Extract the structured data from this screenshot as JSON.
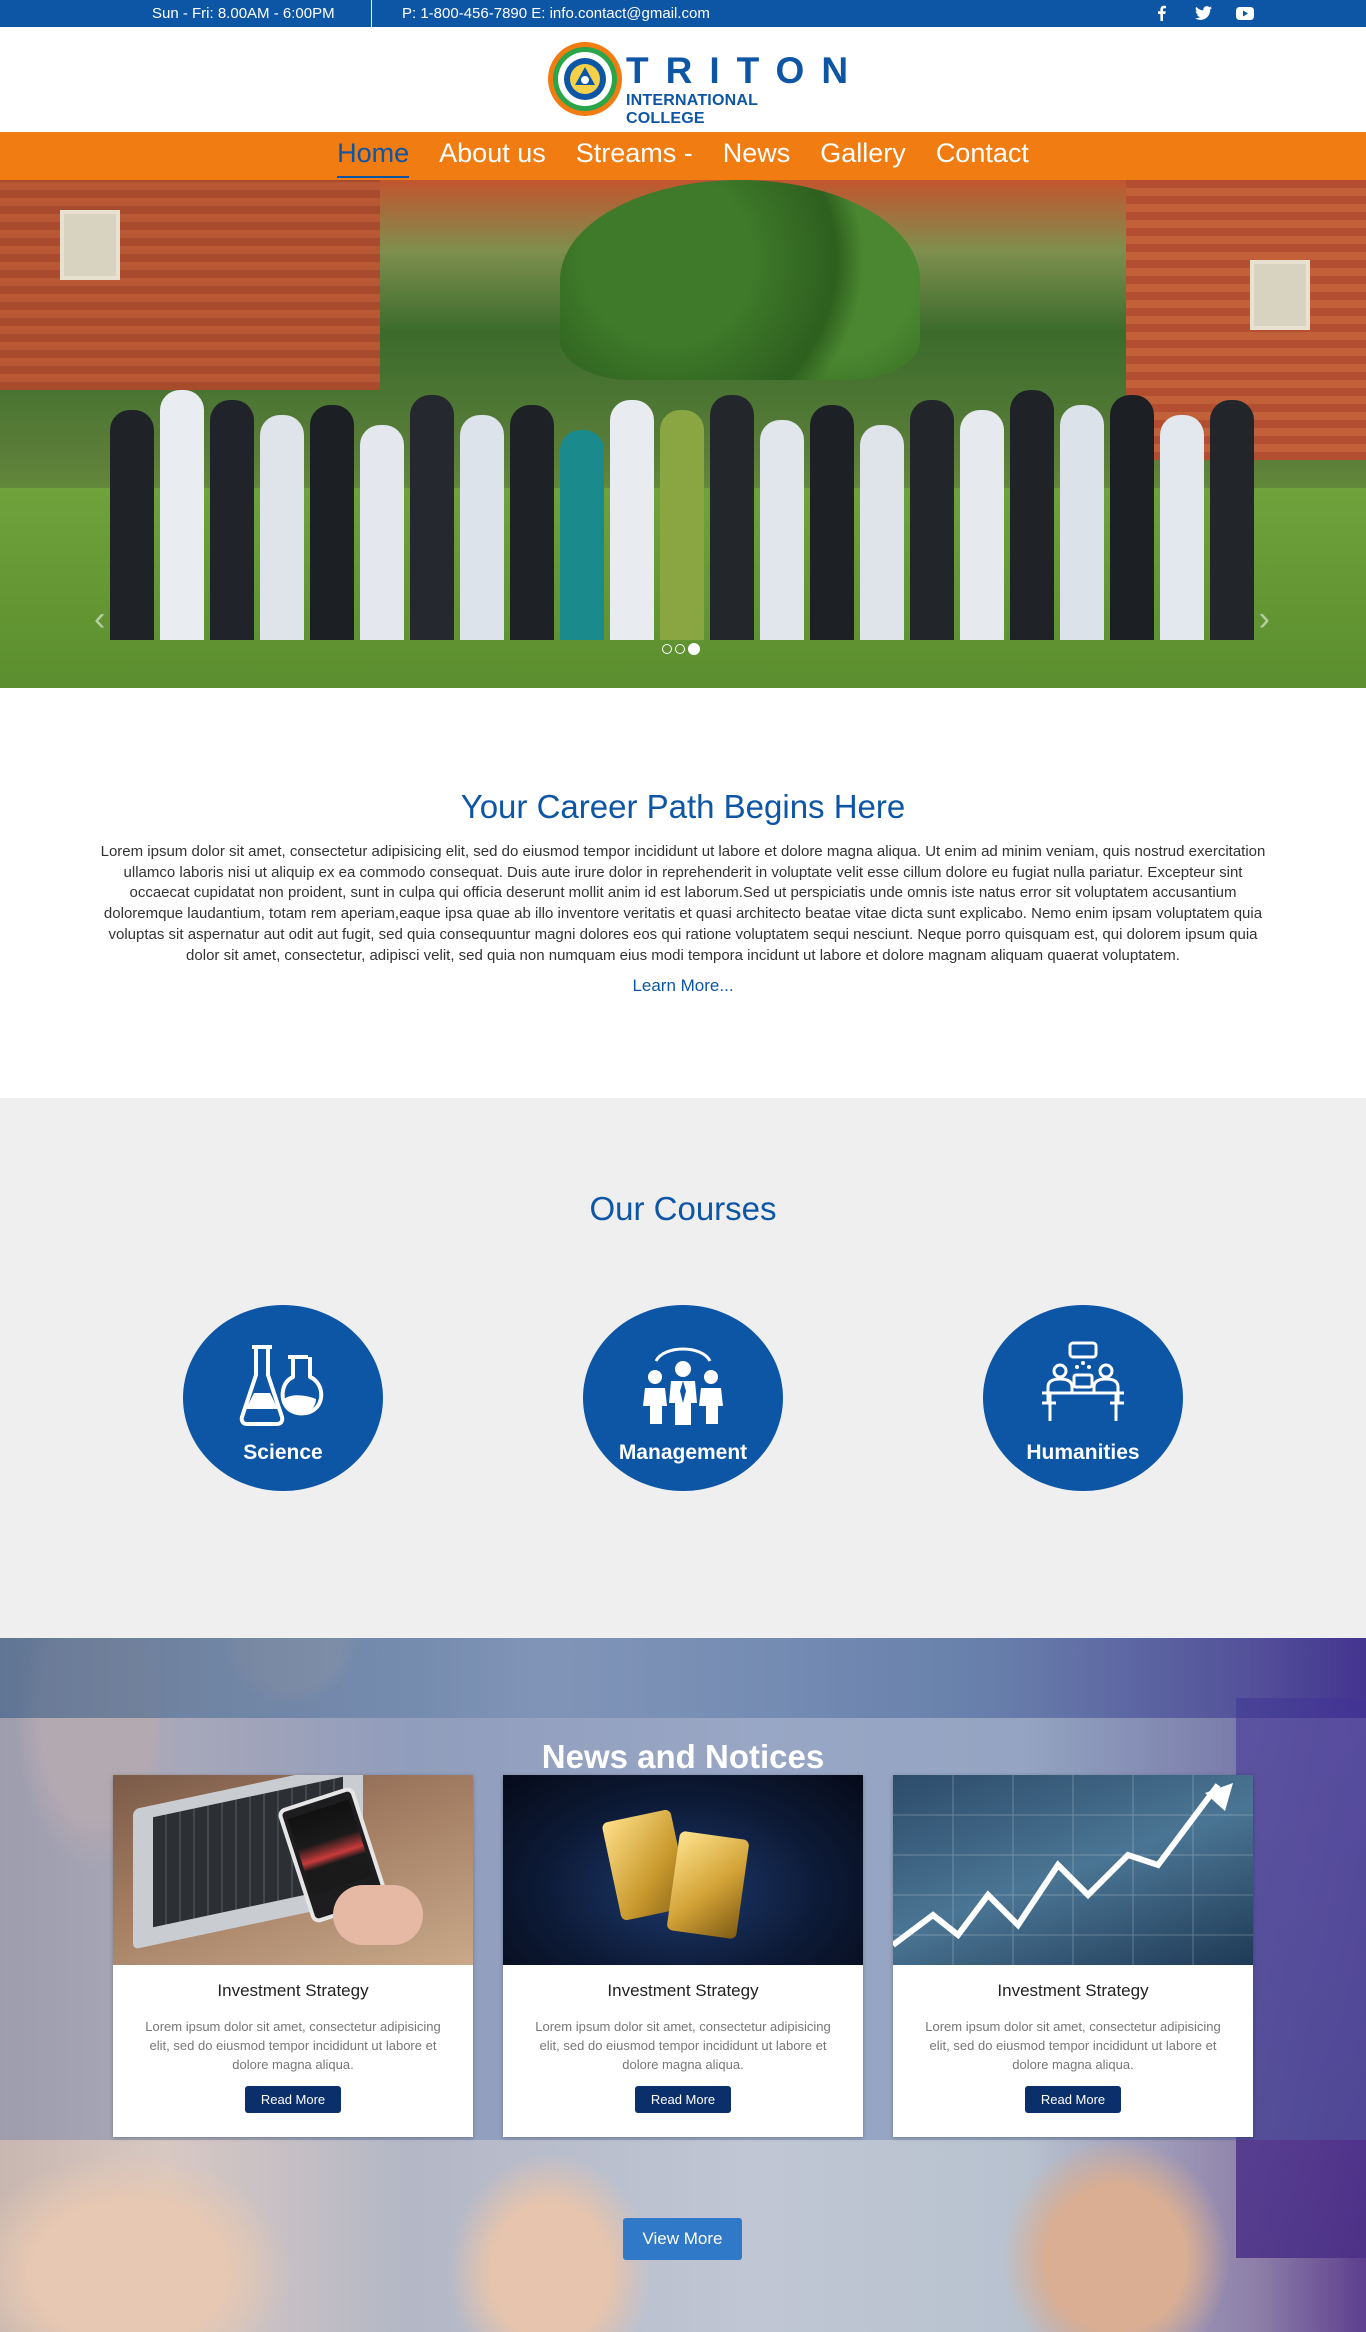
{
  "topbar": {
    "hours": "Sun - Fri: 8.00AM - 6:00PM",
    "contact": "P: 1-800-456-7890  E: info.contact@gmail.com",
    "social": [
      "facebook-icon",
      "twitter-icon",
      "youtube-icon"
    ]
  },
  "logo": {
    "name": "TRITON",
    "subtitle": "INTERNATIONAL COLLEGE"
  },
  "nav": {
    "items": [
      "Home",
      "About us",
      "Streams -",
      "News",
      "Gallery",
      "Contact"
    ]
  },
  "career": {
    "title": "Your Career Path Begins Here",
    "body": "Lorem ipsum dolor sit amet, consectetur adipisicing elit, sed do eiusmod tempor incididunt ut labore et dolore magna aliqua. Ut enim ad minim veniam, quis nostrud exercitation ullamco laboris nisi ut aliquip ex ea commodo consequat. Duis aute irure dolor in reprehenderit in voluptate velit esse cillum dolore eu fugiat nulla pariatur. Excepteur sint occaecat cupidatat non proident, sunt in culpa qui officia deserunt mollit anim id est laborum.Sed ut perspiciatis unde omnis iste natus error sit voluptatem accusantium doloremque laudantium, totam rem aperiam,eaque ipsa quae ab illo inventore veritatis et quasi architecto beatae vitae dicta sunt explicabo. Nemo enim ipsam voluptatem quia voluptas sit aspernatur aut odit aut fugit, sed quia consequuntur magni dolores eos qui ratione voluptatem sequi nesciunt. Neque porro quisquam est, qui dolorem ipsum quia dolor sit amet, consectetur, adipisci velit, sed quia non numquam eius modi tempora incidunt ut labore et dolore magnam aliquam quaerat voluptatem.",
    "link": "Learn More..."
  },
  "courses": {
    "title": "Our Courses",
    "items": [
      {
        "label": "Science",
        "icon": "flask-icon"
      },
      {
        "label": "Management",
        "icon": "people-icon"
      },
      {
        "label": "Humanities",
        "icon": "discussion-icon"
      }
    ]
  },
  "news": {
    "title": "News and Notices",
    "cards": [
      {
        "title": "Investment Strategy",
        "desc": "Lorem ipsum dolor sit amet, consectetur adipisicing elit, sed do eiusmod tempor incididunt ut labore et dolore magna aliqua.",
        "button": "Read More"
      },
      {
        "title": "Investment Strategy",
        "desc": "Lorem ipsum dolor sit amet, consectetur adipisicing elit, sed do eiusmod tempor incididunt ut labore et dolore magna aliqua.",
        "button": "Read More"
      },
      {
        "title": "Investment Strategy",
        "desc": "Lorem ipsum dolor sit amet, consectetur adipisicing elit, sed do eiusmod tempor incididunt ut labore et dolore magna aliqua.",
        "button": "Read More"
      }
    ],
    "view_more": "View More"
  },
  "hero": {
    "active_slide": 3,
    "slide_count": 3
  },
  "colors": {
    "primary": "#0d55a5",
    "nav": "#f07c12",
    "button_dark": "#0a2f6b"
  }
}
